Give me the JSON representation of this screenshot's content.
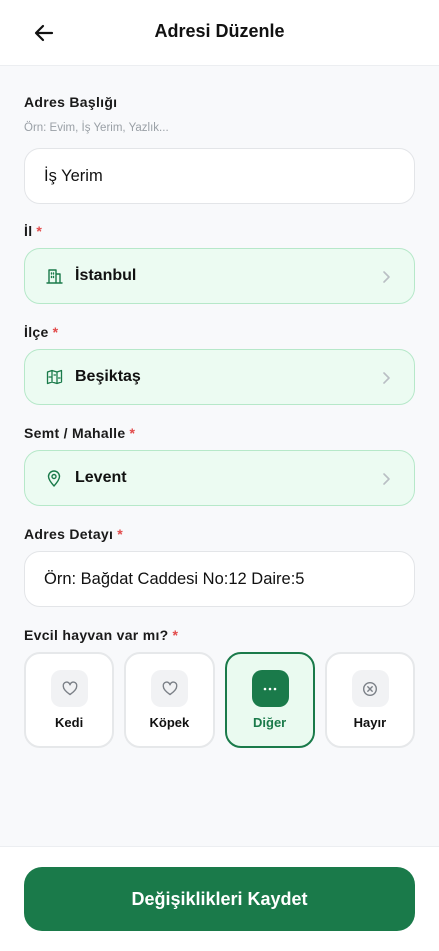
{
  "header": {
    "title": "Adresi Düzenle"
  },
  "form": {
    "address_title": {
      "label": "Adres Başlığı",
      "hint": "Örn: Evim, İş Yerim, Yazlık...",
      "value": "İş Yerim"
    },
    "city": {
      "label": "İl",
      "required_mark": "*",
      "value": "İstanbul"
    },
    "district": {
      "label": "İlçe",
      "required_mark": "*",
      "value": "Beşiktaş"
    },
    "neighborhood": {
      "label": "Semt / Mahalle",
      "required_mark": "*",
      "value": "Levent"
    },
    "address_detail": {
      "label": "Adres Detayı",
      "required_mark": "*",
      "placeholder": "Örn: Bağdat Caddesi No:12 Daire:5"
    },
    "pets": {
      "label": "Evcil hayvan var mı?",
      "required_mark": "*",
      "options": [
        {
          "label": "Kedi",
          "icon": "heart-icon"
        },
        {
          "label": "Köpek",
          "icon": "heart-icon"
        },
        {
          "label": "Diğer",
          "icon": "more-dots-icon",
          "selected": true
        },
        {
          "label": "Hayır",
          "icon": "x-circle-icon"
        }
      ]
    }
  },
  "footer": {
    "save_label": "Değişiklikleri Kaydet"
  },
  "colors": {
    "primary": "#1a7a4a",
    "select_bg": "#ecfbf2",
    "select_border": "#b6e8c9",
    "required": "#e24b4b"
  }
}
